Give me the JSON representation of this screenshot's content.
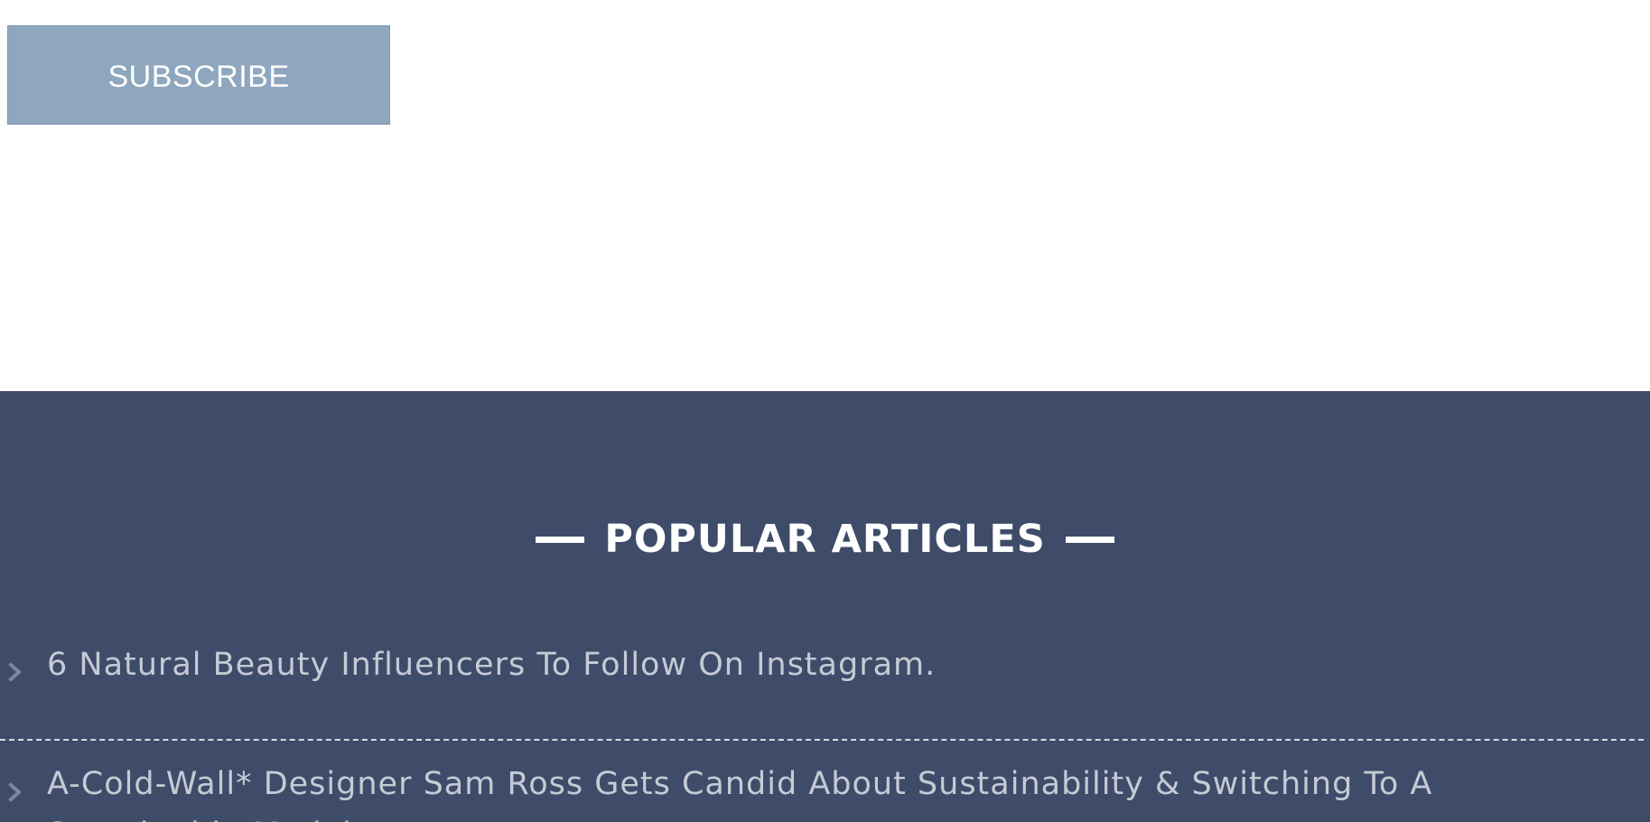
{
  "subscribe": {
    "label": "SUBSCRIBE"
  },
  "popular_articles": {
    "heading": "POPULAR ARTICLES",
    "items": [
      {
        "title": "6 Natural Beauty Influencers To Follow On Instagram."
      },
      {
        "title": "A-Cold-Wall* Designer Sam Ross Gets Candid About Sustainability & Switching To A Sustainable Model"
      }
    ]
  },
  "icons": {
    "article_arrow": "chevron-right-icon",
    "heading_decoration": "horizontal-rule-icon"
  },
  "colors": {
    "subscribe_button": "#8ea7bf",
    "section_background": "#3e4b69",
    "heading_text": "#ffffff",
    "article_text": "#c5cad4",
    "chevron": "#7d879a",
    "divider": "#d5dae3"
  }
}
